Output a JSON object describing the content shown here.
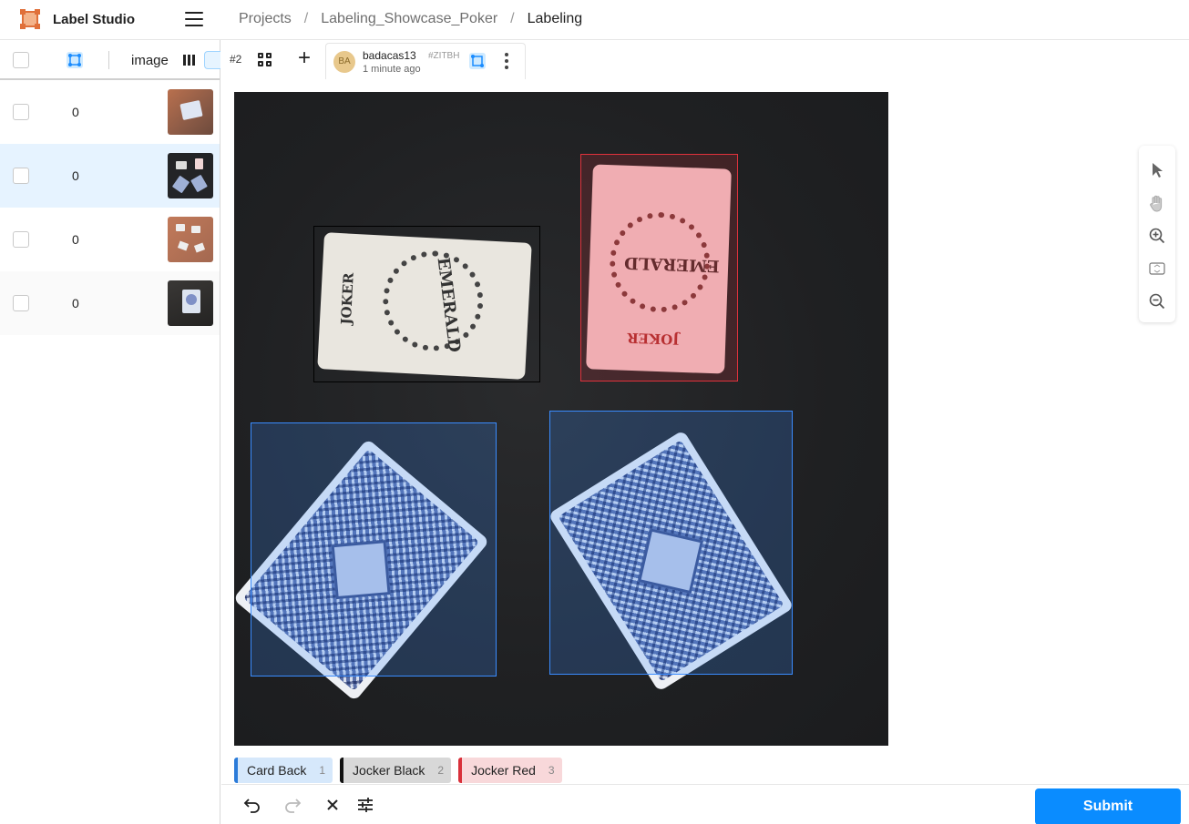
{
  "header": {
    "app_name": "Label Studio",
    "breadcrumbs": [
      "Projects",
      "Labeling_Showcase_Poker",
      "Labeling"
    ],
    "separator": "/"
  },
  "task_list": {
    "column_image": "image",
    "rows": [
      {
        "count": "0",
        "selected": false
      },
      {
        "count": "0",
        "selected": true
      },
      {
        "count": "0",
        "selected": false
      },
      {
        "count": "0",
        "selected": false
      }
    ]
  },
  "editor": {
    "task_id": "#2",
    "add_label": "+",
    "annotation": {
      "avatar": "BA",
      "user": "badacas13",
      "hash": "#ZITBH",
      "time": "1 minute ago"
    },
    "canvas_text": {
      "joker": "JOKER",
      "emerald": "EMERALD"
    }
  },
  "labels": [
    {
      "name": "Card Back",
      "hotkey": "1",
      "color": "#2b7bd9",
      "bg": "#d6e8fb"
    },
    {
      "name": "Jocker Black",
      "hotkey": "2",
      "color": "#111111",
      "bg": "#d8d8d8"
    },
    {
      "name": "Jocker Red",
      "hotkey": "3",
      "color": "#d9303a",
      "bg": "#f8d8da"
    }
  ],
  "regions": [
    {
      "label": "Jocker Black",
      "color": "#000000"
    },
    {
      "label": "Jocker Red",
      "color": "#e0323c"
    },
    {
      "label": "Card Back",
      "color": "#3a8cff"
    },
    {
      "label": "Card Back",
      "color": "#3a8cff"
    }
  ],
  "bottom": {
    "submit_label": "Submit"
  }
}
